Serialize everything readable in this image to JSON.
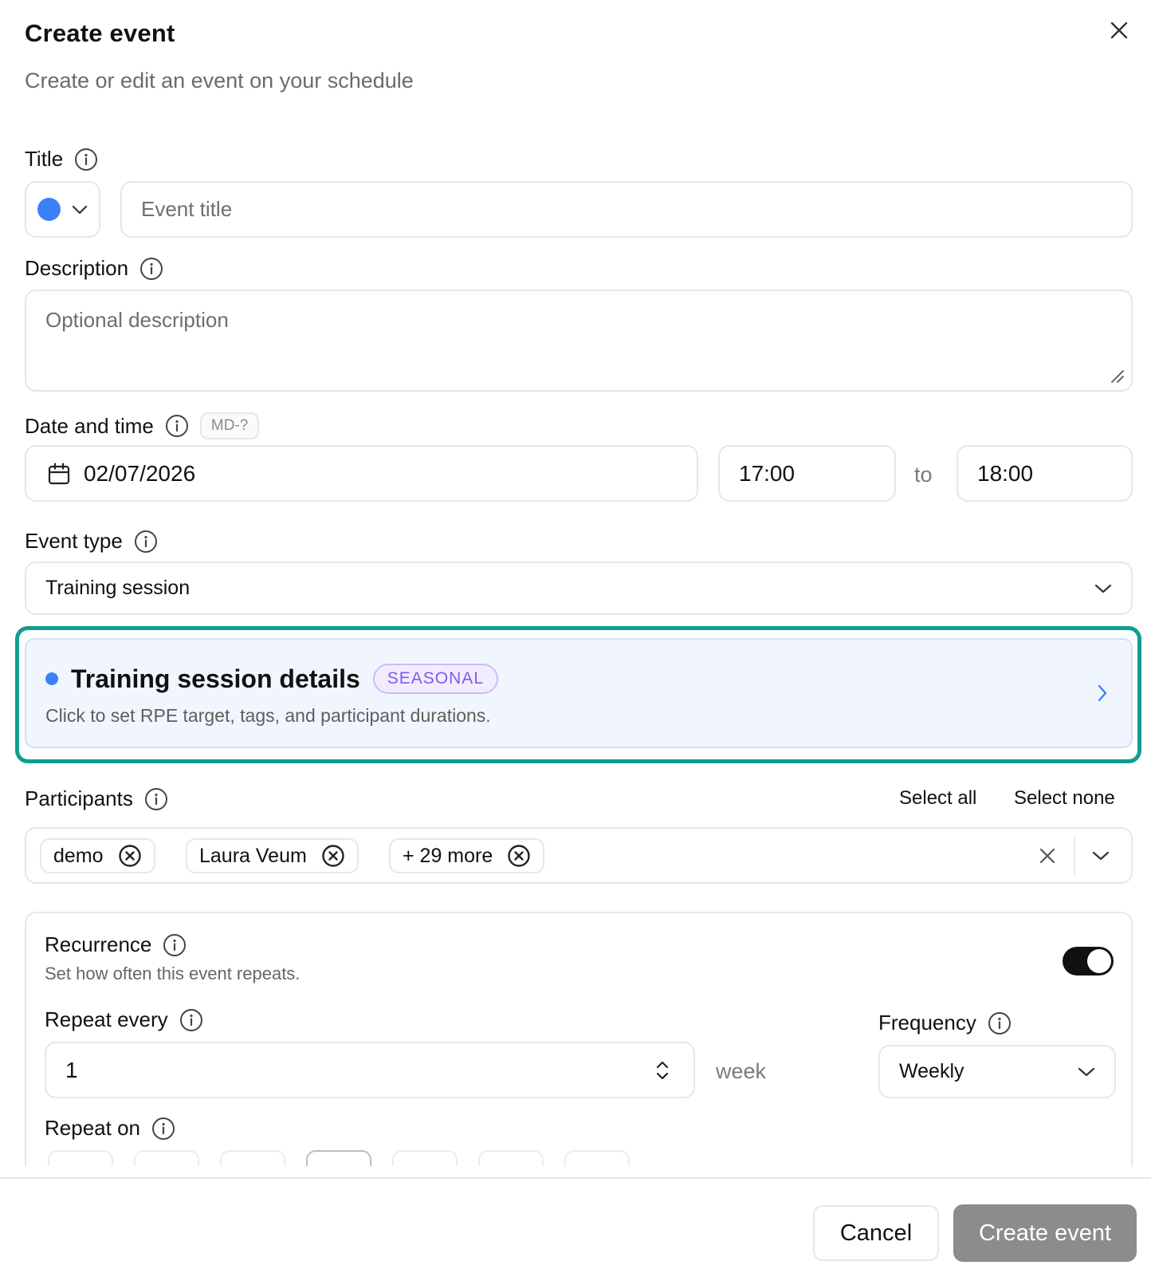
{
  "header": {
    "title": "Create event",
    "subtitle": "Create or edit an event on your schedule"
  },
  "title_field": {
    "label": "Title",
    "placeholder": "Event title",
    "color": "#3b82f6"
  },
  "description_field": {
    "label": "Description",
    "placeholder": "Optional description"
  },
  "date_time": {
    "label": "Date and time",
    "tag": "MD-?",
    "date": "02/07/2026",
    "start": "17:00",
    "separator": "to",
    "end": "18:00"
  },
  "event_type": {
    "label": "Event type",
    "selected": "Training session"
  },
  "details_card": {
    "title": "Training session details",
    "badge": "SEASONAL",
    "hint": "Click to set RPE target, tags, and participant durations."
  },
  "participants": {
    "label": "Participants",
    "select_all": "Select all",
    "select_none": "Select none",
    "chips": [
      "demo",
      "Laura Veum",
      "+ 29 more"
    ]
  },
  "recurrence": {
    "label": "Recurrence",
    "hint": "Set how often this event repeats.",
    "enabled": true,
    "repeat_every_label": "Repeat every",
    "repeat_every_value": "1",
    "unit": "week",
    "frequency_label": "Frequency",
    "frequency_value": "Weekly",
    "repeat_on_label": "Repeat on"
  },
  "footer": {
    "cancel": "Cancel",
    "create": "Create event"
  },
  "colors": {
    "accent_blue": "#3b82f6",
    "highlight_teal": "#0f9e90",
    "badge_purple": "#7c5cf0",
    "create_disabled": "#8c8c8c"
  }
}
